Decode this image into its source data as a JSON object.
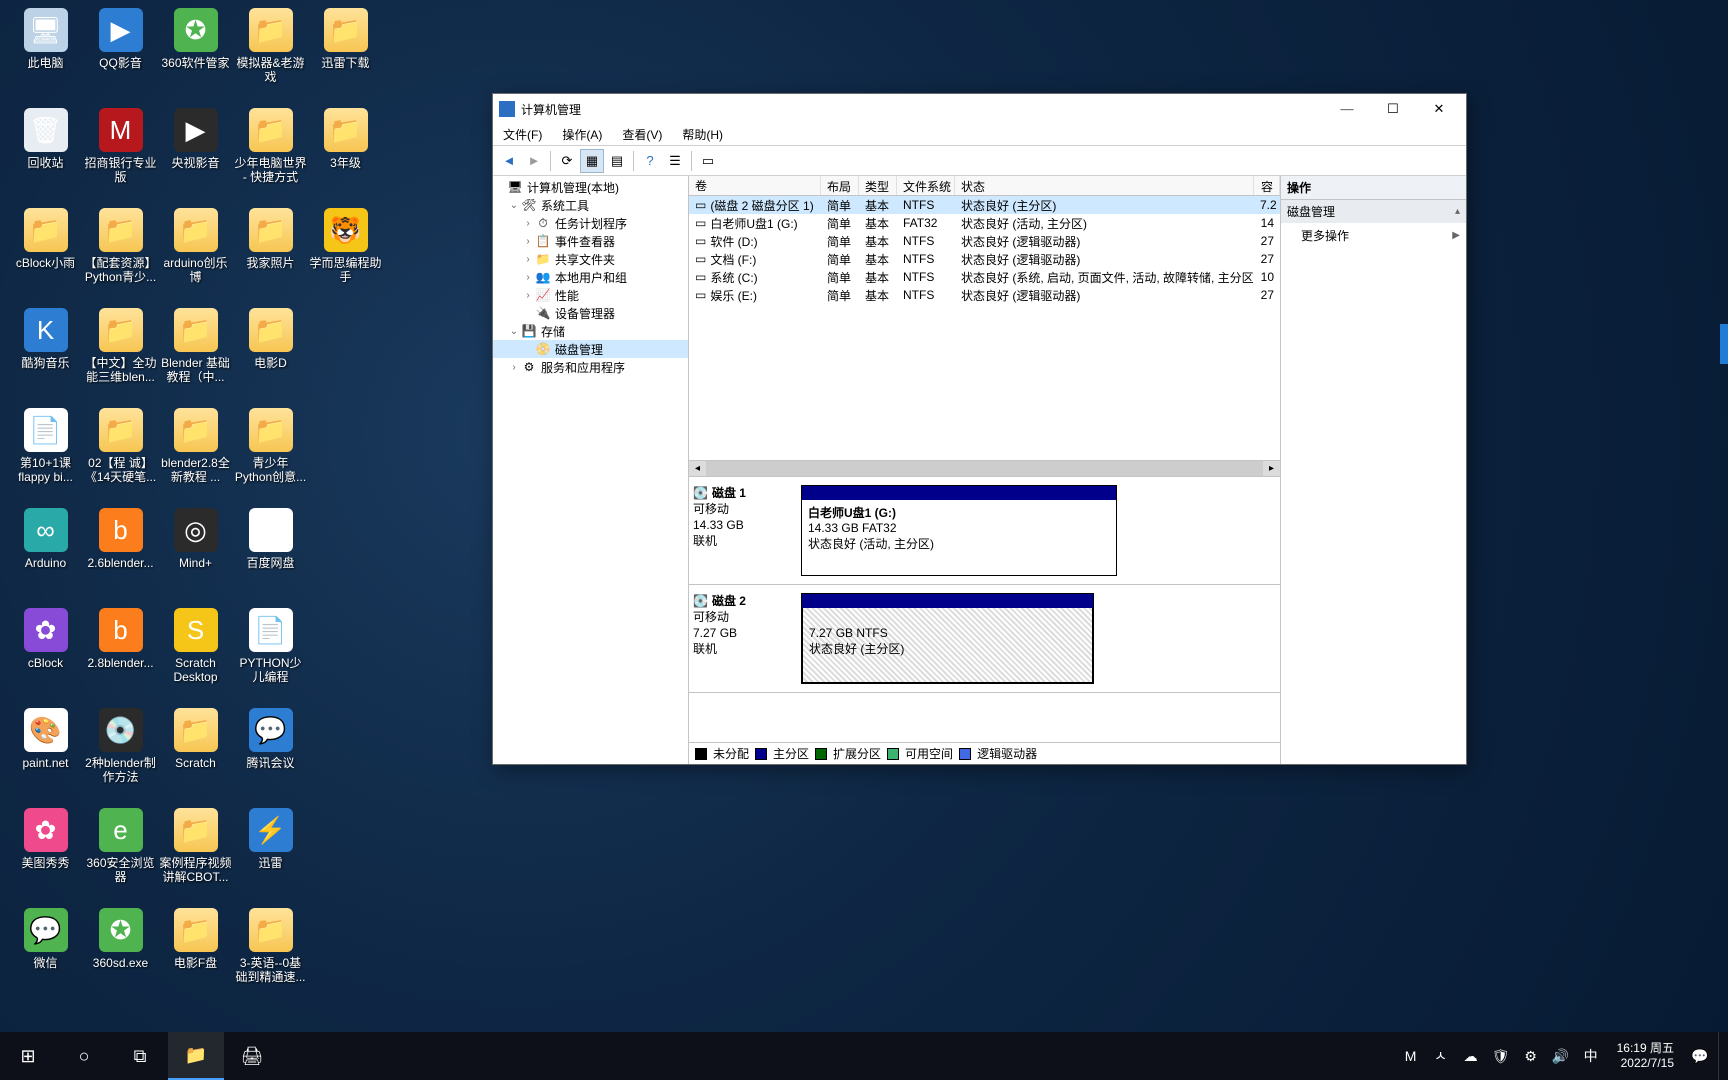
{
  "desktop_icons": [
    {
      "label": "此电脑",
      "cls": "pc",
      "glyph": "🖥"
    },
    {
      "label": "QQ影音",
      "cls": "blue",
      "glyph": "▶"
    },
    {
      "label": "360软件管家",
      "cls": "green",
      "glyph": "✪"
    },
    {
      "label": "模拟器&老游戏",
      "cls": "folder",
      "glyph": "📁"
    },
    {
      "label": "迅雷下载",
      "cls": "folder",
      "glyph": "📁"
    },
    {
      "label": "回收站",
      "cls": "bin",
      "glyph": "🗑"
    },
    {
      "label": "招商银行专业版",
      "cls": "red",
      "glyph": "M"
    },
    {
      "label": "央视影音",
      "cls": "dark",
      "glyph": "▶"
    },
    {
      "label": "少年电脑世界 - 快捷方式",
      "cls": "folder",
      "glyph": "📁"
    },
    {
      "label": "3年级",
      "cls": "folder",
      "glyph": "📁"
    },
    {
      "label": "cBlock小雨",
      "cls": "folder",
      "glyph": "📁"
    },
    {
      "label": "【配套资源】Python青少...",
      "cls": "folder",
      "glyph": "📁"
    },
    {
      "label": "arduino创乐博",
      "cls": "folder",
      "glyph": "📁"
    },
    {
      "label": "我家照片",
      "cls": "folder",
      "glyph": "📁"
    },
    {
      "label": "学而思编程助手",
      "cls": "yellow",
      "glyph": "🐯"
    },
    {
      "label": "酷狗音乐",
      "cls": "blue",
      "glyph": "K"
    },
    {
      "label": "【中文】全功能三维blen...",
      "cls": "folder",
      "glyph": "📁"
    },
    {
      "label": "Blender 基础教程（中...",
      "cls": "folder",
      "glyph": "📁"
    },
    {
      "label": "电影D",
      "cls": "folder",
      "glyph": "📁"
    },
    {
      "label": "",
      "cls": "",
      "glyph": ""
    },
    {
      "label": "第10+1课 flappy bi...",
      "cls": "white",
      "glyph": "📄"
    },
    {
      "label": "02【程 诚】《14天硬笔...",
      "cls": "folder",
      "glyph": "📁"
    },
    {
      "label": "blender2.8全新教程 ...",
      "cls": "folder",
      "glyph": "📁"
    },
    {
      "label": "青少年Python创意...",
      "cls": "folder",
      "glyph": "📁"
    },
    {
      "label": "",
      "cls": "",
      "glyph": ""
    },
    {
      "label": "Arduino",
      "cls": "teal",
      "glyph": "∞"
    },
    {
      "label": "2.6blender...",
      "cls": "orange",
      "glyph": "b"
    },
    {
      "label": "Mind+",
      "cls": "dark",
      "glyph": "◎"
    },
    {
      "label": "百度网盘",
      "cls": "white",
      "glyph": "☁"
    },
    {
      "label": "",
      "cls": "",
      "glyph": ""
    },
    {
      "label": "cBlock",
      "cls": "purple",
      "glyph": "✿"
    },
    {
      "label": "2.8blender...",
      "cls": "orange",
      "glyph": "b"
    },
    {
      "label": "Scratch Desktop",
      "cls": "yellow",
      "glyph": "S"
    },
    {
      "label": "PYTHON少儿编程",
      "cls": "white",
      "glyph": "📄"
    },
    {
      "label": "",
      "cls": "",
      "glyph": ""
    },
    {
      "label": "paint.net",
      "cls": "white",
      "glyph": "🎨"
    },
    {
      "label": "2种blender制作方法",
      "cls": "dark",
      "glyph": "💿"
    },
    {
      "label": "Scratch",
      "cls": "folder",
      "glyph": "📁"
    },
    {
      "label": "腾讯会议",
      "cls": "blue",
      "glyph": "💬"
    },
    {
      "label": "",
      "cls": "",
      "glyph": ""
    },
    {
      "label": "美图秀秀",
      "cls": "pink",
      "glyph": "✿"
    },
    {
      "label": "360安全浏览器",
      "cls": "green",
      "glyph": "e"
    },
    {
      "label": "案例程序视频讲解CBOT...",
      "cls": "folder",
      "glyph": "📁"
    },
    {
      "label": "迅雷",
      "cls": "blue",
      "glyph": "⚡"
    },
    {
      "label": "",
      "cls": "",
      "glyph": ""
    },
    {
      "label": "微信",
      "cls": "green",
      "glyph": "💬"
    },
    {
      "label": "360sd.exe",
      "cls": "green",
      "glyph": "✪"
    },
    {
      "label": "电影F盘",
      "cls": "folder",
      "glyph": "📁"
    },
    {
      "label": "3-英语--0基础到精通速...",
      "cls": "folder",
      "glyph": "📁"
    }
  ],
  "window": {
    "title": "计算机管理",
    "menu": [
      "文件(F)",
      "操作(A)",
      "查看(V)",
      "帮助(H)"
    ],
    "nav": {
      "root": "计算机管理(本地)",
      "tools_hdr": "系统工具",
      "tools": [
        "任务计划程序",
        "事件查看器",
        "共享文件夹",
        "本地用户和组",
        "性能",
        "设备管理器"
      ],
      "storage_hdr": "存储",
      "storage_item": "磁盘管理",
      "services": "服务和应用程序"
    },
    "columns": {
      "vol": "卷",
      "layout": "布局",
      "type": "类型",
      "fs": "文件系统",
      "status": "状态",
      "cap": "容"
    },
    "volumes": [
      {
        "name": "(磁盘 2 磁盘分区 1)",
        "layout": "简单",
        "type": "基本",
        "fs": "NTFS",
        "status": "状态良好 (主分区)",
        "cap": "7.2",
        "sel": true
      },
      {
        "name": "白老师U盘1 (G:)",
        "layout": "简单",
        "type": "基本",
        "fs": "FAT32",
        "status": "状态良好 (活动, 主分区)",
        "cap": "14"
      },
      {
        "name": "软件 (D:)",
        "layout": "简单",
        "type": "基本",
        "fs": "NTFS",
        "status": "状态良好 (逻辑驱动器)",
        "cap": "27"
      },
      {
        "name": "文档 (F:)",
        "layout": "简单",
        "type": "基本",
        "fs": "NTFS",
        "status": "状态良好 (逻辑驱动器)",
        "cap": "27"
      },
      {
        "name": "系统 (C:)",
        "layout": "简单",
        "type": "基本",
        "fs": "NTFS",
        "status": "状态良好 (系统, 启动, 页面文件, 活动, 故障转储, 主分区)",
        "cap": "10"
      },
      {
        "name": "娱乐 (E:)",
        "layout": "简单",
        "type": "基本",
        "fs": "NTFS",
        "status": "状态良好 (逻辑驱动器)",
        "cap": "27"
      }
    ],
    "disk1": {
      "hdr": "磁盘 1",
      "type": "可移动",
      "size": "14.33 GB",
      "state": "联机",
      "part_name": "白老师U盘1  (G:)",
      "part_l2": "14.33 GB FAT32",
      "part_l3": "状态良好 (活动, 主分区)"
    },
    "disk2": {
      "hdr": "磁盘 2",
      "type": "可移动",
      "size": "7.27 GB",
      "state": "联机",
      "part_l2": "7.27 GB NTFS",
      "part_l3": "状态良好 (主分区)"
    },
    "legend": {
      "unalloc": "未分配",
      "primary": "主分区",
      "ext": "扩展分区",
      "free": "可用空间",
      "logical": "逻辑驱动器"
    },
    "actions": {
      "hdr": "操作",
      "sub": "磁盘管理",
      "more": "更多操作"
    }
  },
  "taskbar": {
    "ime": "M",
    "lang": "中",
    "up": "ㅅ",
    "time": "16:19 周五",
    "date": "2022/7/15"
  }
}
